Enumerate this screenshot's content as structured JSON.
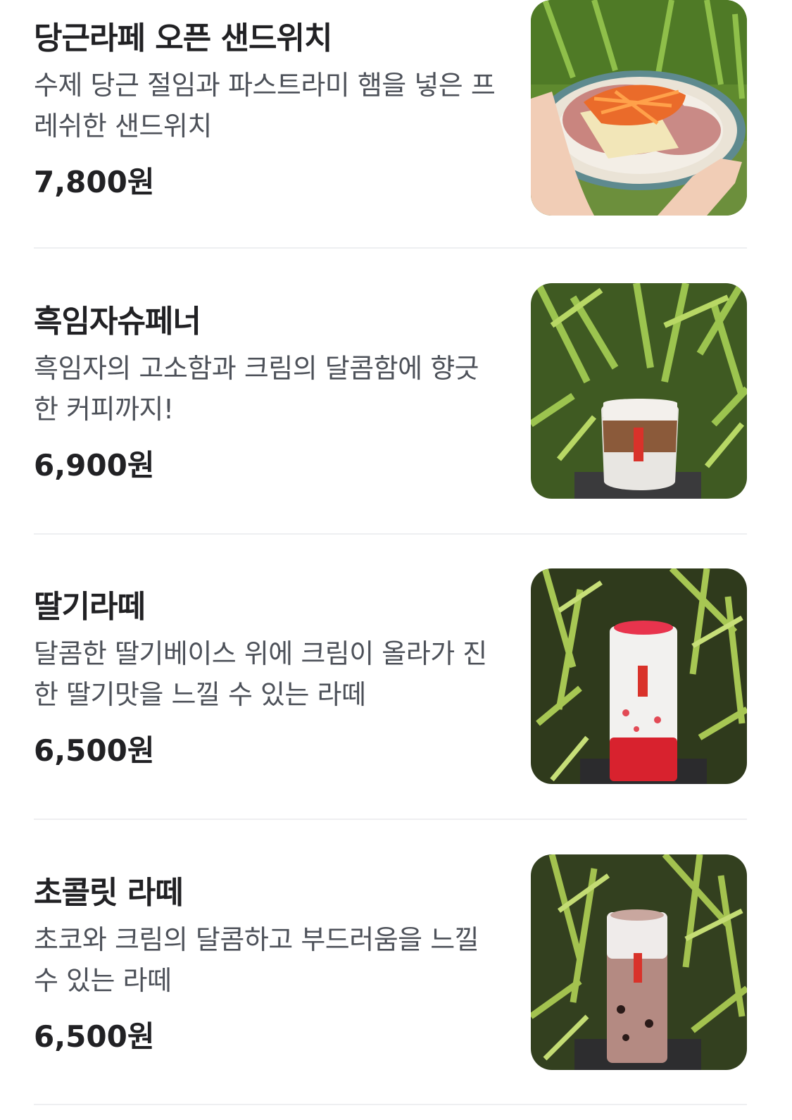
{
  "menu": {
    "items": [
      {
        "name": "당근라페 오픈 샌드위치",
        "description": "수제 당근 절임과 파스트라미 햄을 넣은 프레쉬한 샌드위치",
        "price": "7,800원",
        "image": "open-sandwich-photo"
      },
      {
        "name": "흑임자슈페너",
        "description": "흑임자의 고소함과 크림의 달콤함에 향긋한 커피까지!",
        "price": "6,900원",
        "image": "black-sesame-einspanner-photo"
      },
      {
        "name": "딸기라떼",
        "description": "달콤한 딸기베이스 위에 크림이 올라가 진한 딸기맛을 느낄 수 있는 라떼",
        "price": "6,500원",
        "image": "strawberry-latte-photo"
      },
      {
        "name": "초콜릿 라떼",
        "description": "초코와 크림의 달콤하고 부드러움을 느낄 수 있는 라떼",
        "price": "6,500원",
        "image": "chocolate-latte-photo"
      }
    ]
  }
}
